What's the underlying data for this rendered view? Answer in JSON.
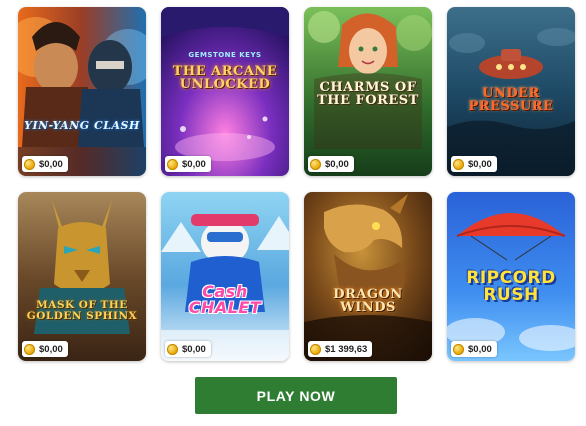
{
  "games": [
    {
      "title": "YIN-YANG CLASH",
      "price": "$0,00"
    },
    {
      "supertitle": "GEMSTONE KEYS",
      "title": "THE ARCANE UNLOCKED",
      "price": "$0,00"
    },
    {
      "title": "CHARMS OF THE FOREST",
      "price": "$0,00"
    },
    {
      "title": "UNDER PRESSURE",
      "price": "$0,00"
    },
    {
      "title": "MASK OF THE GOLDEN SPHINX",
      "price": "$0,00"
    },
    {
      "title": "Cash CHALET",
      "price": "$0,00"
    },
    {
      "title": "DRAGON WINDS",
      "price": "$1 399,63"
    },
    {
      "title": "RIPCORD RUSH",
      "price": "$0,00"
    }
  ],
  "play_button": {
    "label": "PLAY NOW",
    "color": "#2e7d32"
  },
  "icons": {
    "price_icon": "coin-icon"
  }
}
